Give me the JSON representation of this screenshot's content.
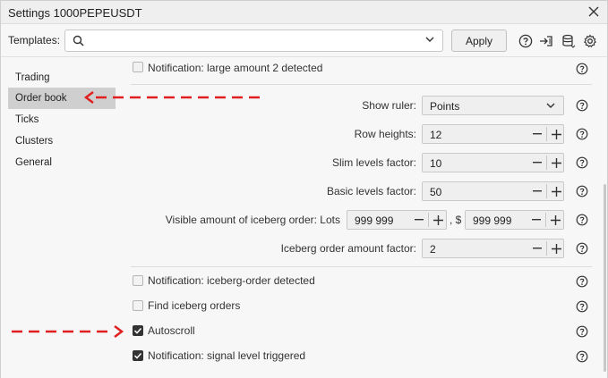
{
  "window": {
    "title": "Settings 1000PEPEUSDT"
  },
  "templates": {
    "label": "Templates:",
    "placeholder": "",
    "apply_label": "Apply"
  },
  "sidebar": {
    "items": [
      {
        "label": "Trading"
      },
      {
        "label": "Order book",
        "active": true
      },
      {
        "label": "Ticks"
      },
      {
        "label": "Clusters"
      },
      {
        "label": "General"
      }
    ]
  },
  "settings": {
    "top_notification": {
      "label": "Notification: large amount 2 detected",
      "checked": false
    },
    "show_ruler": {
      "label": "Show ruler:",
      "value": "Points"
    },
    "row_heights": {
      "label": "Row heights:",
      "value": "12"
    },
    "slim_levels_factor": {
      "label": "Slim levels factor:",
      "value": "10"
    },
    "basic_levels_factor": {
      "label": "Basic levels factor:",
      "value": "50"
    },
    "visible_iceberg": {
      "label": "Visible amount of iceberg order: Lots",
      "lots_value": "999 999",
      "separator": ", $",
      "usd_value": "999 999"
    },
    "iceberg_factor": {
      "label": "Iceberg order amount factor:",
      "value": "2"
    },
    "notif_iceberg": {
      "label": "Notification: iceberg-order detected",
      "checked": false
    },
    "find_iceberg": {
      "label": "Find iceberg orders",
      "checked": false
    },
    "autoscroll": {
      "label": "Autoscroll",
      "checked": true
    },
    "notif_signal": {
      "label": "Notification: signal level triggered",
      "checked": true
    }
  },
  "colors": {
    "accent_arrow": "#e02020",
    "active_bg": "#cfcfcf"
  },
  "icons": [
    "close-icon",
    "search-icon",
    "chevron-down-icon",
    "help-icon",
    "import-icon",
    "database-icon",
    "gear-icon",
    "minus-icon",
    "plus-icon",
    "check-icon"
  ]
}
